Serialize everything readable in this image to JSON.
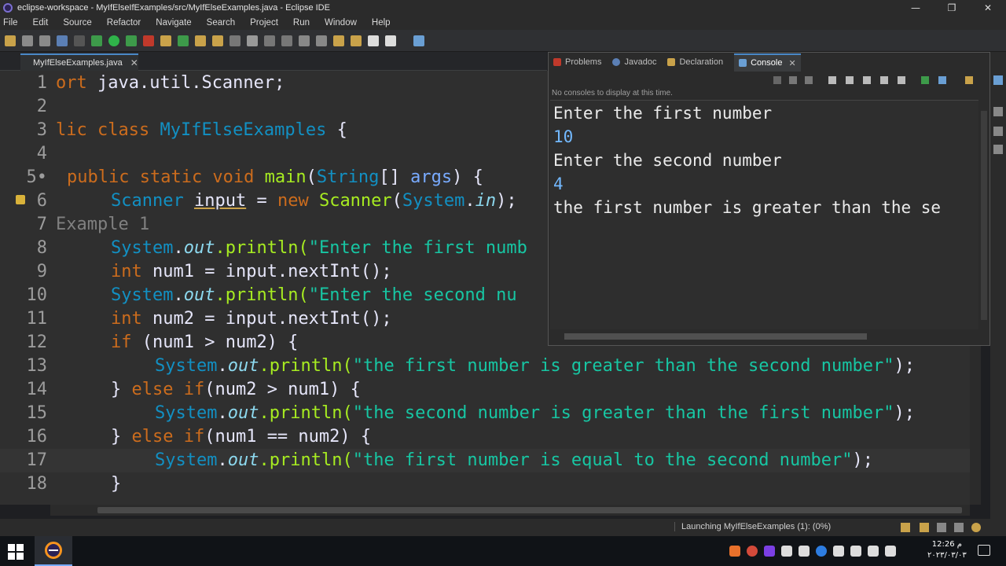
{
  "window": {
    "title": "eclipse-workspace - MyIfElseIfExamples/src/MyIfElseExamples.java - Eclipse IDE",
    "controls": [
      "—",
      "❐",
      "✕"
    ]
  },
  "menu": [
    "File",
    "Edit",
    "Source",
    "Refactor",
    "Navigate",
    "Search",
    "Project",
    "Run",
    "Window",
    "Help"
  ],
  "editor": {
    "tab_label": "MyIfElseExamples.java",
    "tab_close": "✕",
    "lines": [
      {
        "num": "1"
      },
      {
        "num": "2"
      },
      {
        "num": "3"
      },
      {
        "num": "4"
      },
      {
        "num": "5•"
      },
      {
        "num": "6"
      },
      {
        "num": "7"
      },
      {
        "num": "8"
      },
      {
        "num": "9"
      },
      {
        "num": "10"
      },
      {
        "num": "11"
      },
      {
        "num": "12"
      },
      {
        "num": "13"
      },
      {
        "num": "14"
      },
      {
        "num": "15"
      },
      {
        "num": "16"
      },
      {
        "num": "17"
      },
      {
        "num": "18"
      }
    ],
    "code": {
      "l1_a": "ort",
      "l1_b": " java.util.Scanner;",
      "l3_a": "lic class",
      "l3_b": " MyIfElseExamples",
      "l3_c": " {",
      "l5_a": "public static void",
      "l5_b": " main",
      "l5_c": "(",
      "l5_d": "String",
      "l5_e": "[] ",
      "l5_f": "args",
      "l5_g": ") {",
      "l6_a": "Scanner",
      "l6_b": "input",
      "l6_c": " = ",
      "l6_d": "new",
      "l6_e": " Scanner",
      "l6_f": "(",
      "l6_g": "System",
      "l6_h": ".",
      "l6_i": "in",
      "l6_j": ");",
      "l7": "Example 1",
      "l8_a": "System",
      "l8_b": ".",
      "l8_c": "out",
      "l8_d": ".println(",
      "l8_e": "\"Enter the first numb",
      "l9_a": "int",
      "l9_b": " num1 = input.nextInt();",
      "l10_a": "System",
      "l10_b": ".",
      "l10_c": "out",
      "l10_d": ".println(",
      "l10_e": "\"Enter the second nu",
      "l11_a": "int",
      "l11_b": " num2 = input.nextInt();",
      "l12_a": "if",
      "l12_b": " (num1 > num2) {",
      "l13_a": "System",
      "l13_b": ".",
      "l13_c": "out",
      "l13_d": ".println(",
      "l13_e": "\"the first number is greater than the second number\"",
      "l13_f": ");",
      "l14_a": "} ",
      "l14_b": "else if",
      "l14_c": "(num2 > num1) {",
      "l15_a": "System",
      "l15_b": ".",
      "l15_c": "out",
      "l15_d": ".println(",
      "l15_e": "\"the second number is greater than the first number\"",
      "l15_f": ");",
      "l16_a": "} ",
      "l16_b": "else if",
      "l16_c": "(num1 == num2) {",
      "l17_a": "System",
      "l17_b": ".",
      "l17_c": "out",
      "l17_d": ".println(",
      "l17_e": "\"the first number is equal to the second number\"",
      "l17_f": ");",
      "l18": "}"
    }
  },
  "console_view": {
    "tabs": [
      {
        "label": "Problems",
        "icon": "problems-icon"
      },
      {
        "label": "Javadoc",
        "icon": "javadoc-icon"
      },
      {
        "label": "Declaration",
        "icon": "declaration-icon"
      },
      {
        "label": "Console",
        "icon": "console-icon",
        "active": true
      }
    ],
    "tab_close": "✕",
    "status": "No consoles to display at this time.",
    "output": [
      {
        "text": "Enter the first number",
        "kind": "output"
      },
      {
        "text": "10",
        "kind": "input"
      },
      {
        "text": "Enter the second number",
        "kind": "output"
      },
      {
        "text": "4",
        "kind": "input"
      },
      {
        "text": "the first number is greater than the se",
        "kind": "output"
      }
    ]
  },
  "statusbar": {
    "launch_text": "Launching MyIfElseExamples (1): (0%)"
  },
  "taskbar": {
    "clock_time": "12:26 م",
    "clock_date": "٢٠٢٣/٠٣/٠٣"
  },
  "colors": {
    "keyword": "#cc6c1d",
    "type": "#1290c3",
    "string": "#17c6a3",
    "method": "#a7ec21",
    "accent": "#4a88c7"
  }
}
